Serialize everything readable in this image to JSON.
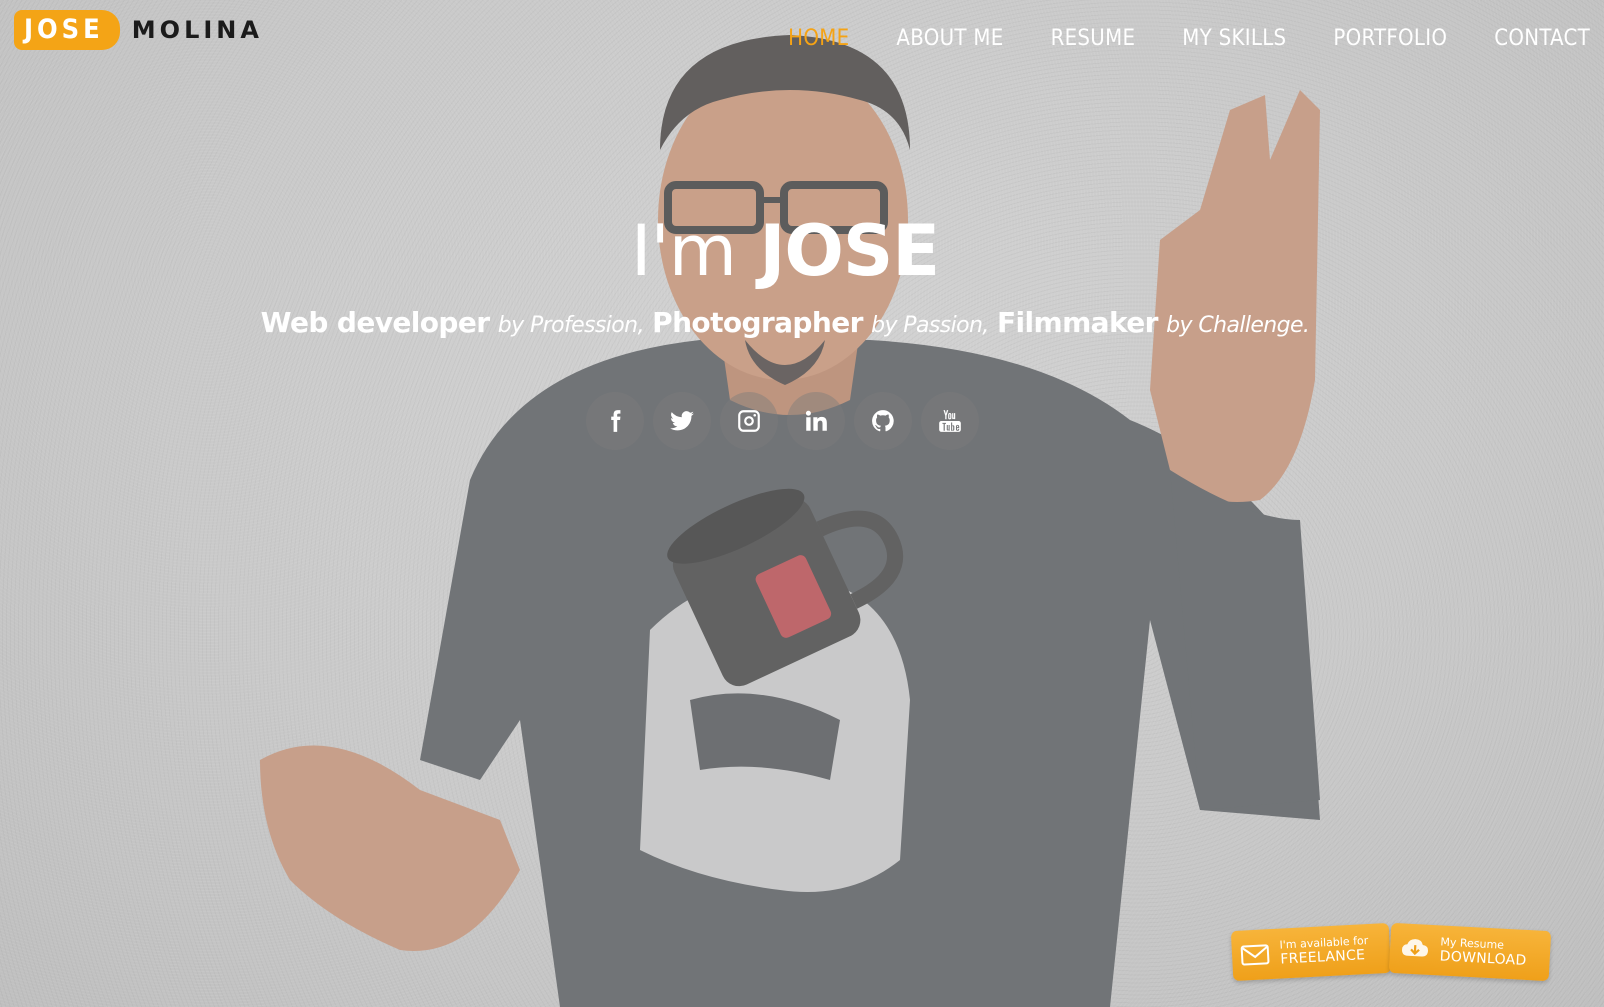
{
  "logo": {
    "first": "JOSE",
    "last": "MOLINA"
  },
  "nav": {
    "items": [
      {
        "label": "HOME",
        "active": true
      },
      {
        "label": "ABOUT ME"
      },
      {
        "label": "RESUME"
      },
      {
        "label": "MY SKILLS"
      },
      {
        "label": "PORTFOLIO"
      },
      {
        "label": "CONTACT"
      }
    ]
  },
  "hero": {
    "greeting": "I'm",
    "name": "JOSE",
    "tagline": {
      "role1": "Web developer",
      "by1": "by Profession,",
      "role2": "Photographer",
      "by2": "by Passion,",
      "role3": "Filmmaker",
      "by3": "by Challenge."
    }
  },
  "social": [
    "facebook-icon",
    "twitter-icon",
    "instagram-icon",
    "linkedin-icon",
    "github-icon",
    "youtube-icon"
  ],
  "buttons": {
    "freelance": {
      "small": "I'm available for",
      "big": "FREELANCE"
    },
    "resume": {
      "small": "My Resume",
      "big": "DOWNLOAD"
    }
  },
  "colors": {
    "accent": "#f5a315",
    "text": "#ffffff",
    "logo_dark": "#1b1b1b"
  }
}
